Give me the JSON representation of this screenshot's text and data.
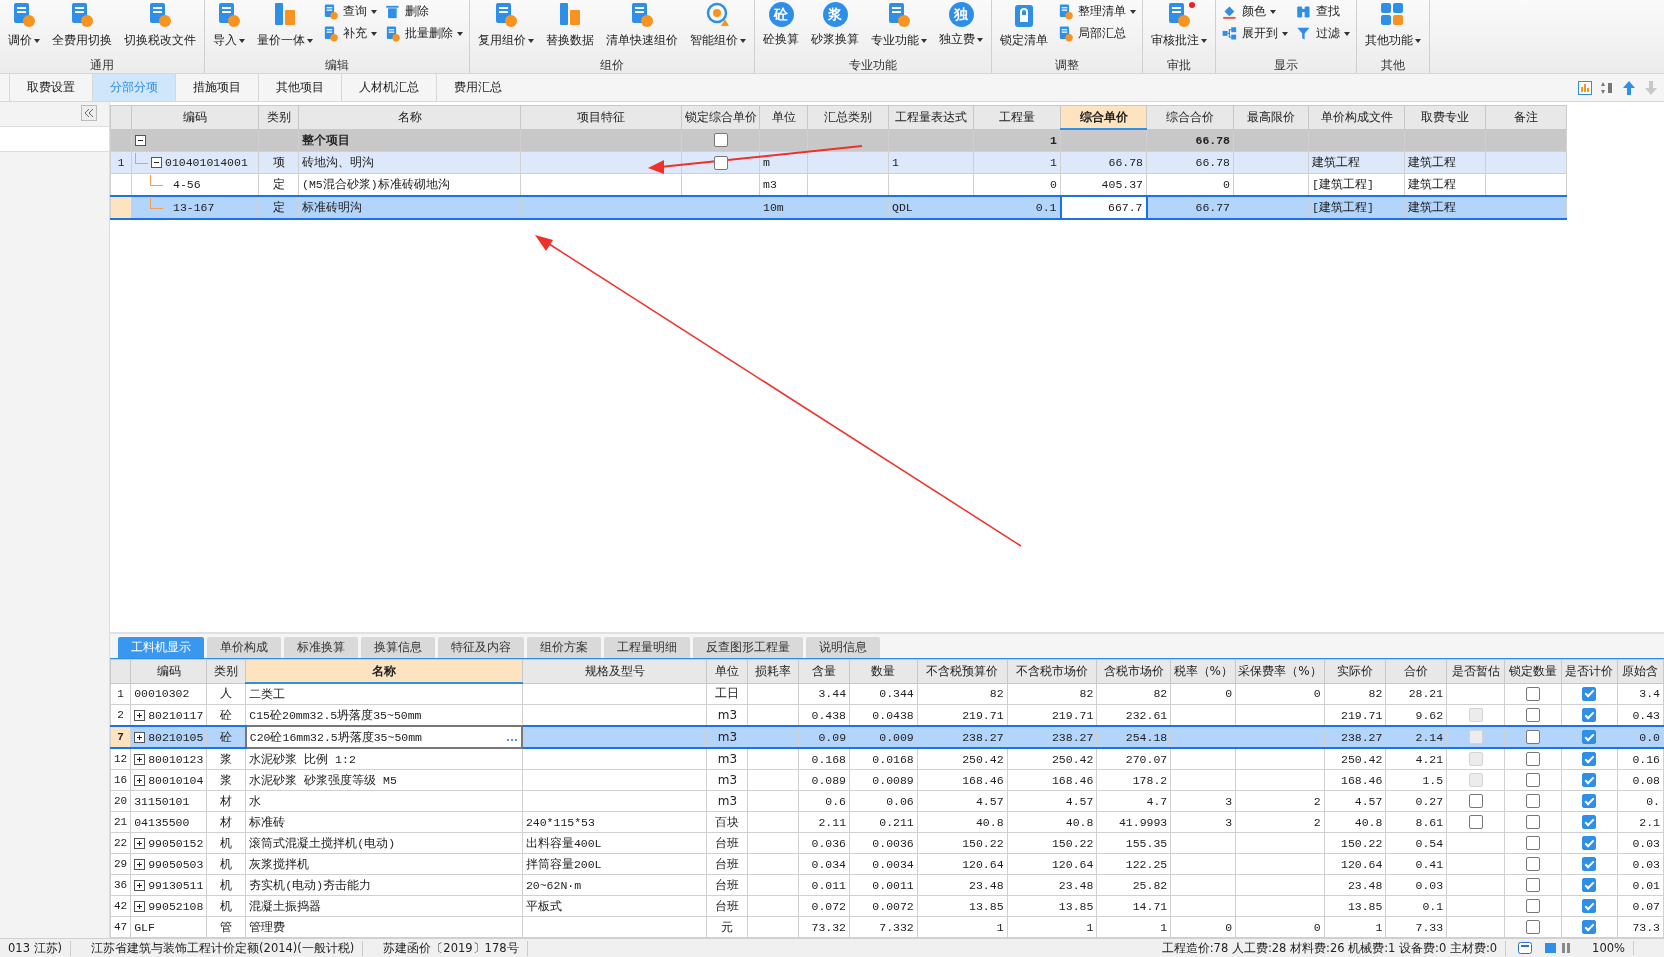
{
  "toolbar": {
    "groups": [
      {
        "label": "通用",
        "items": [
          {
            "kind": "large",
            "label": "调价",
            "dropdown": true
          },
          {
            "kind": "large",
            "label": "全费用切换",
            "dropdown": false
          },
          {
            "kind": "large",
            "label": "切换税改文件",
            "dropdown": false
          }
        ]
      },
      {
        "label": "编辑",
        "items": [
          {
            "kind": "large",
            "label": "导入",
            "dropdown": true
          },
          {
            "kind": "large",
            "label": "量价一体",
            "dropdown": true
          },
          {
            "kind": "stack",
            "items": [
              {
                "label": "查询",
                "dropdown": true
              },
              {
                "label": "补充",
                "dropdown": true
              }
            ]
          },
          {
            "kind": "stack",
            "items": [
              {
                "label": "删除",
                "dropdown": false
              },
              {
                "label": "批量删除",
                "dropdown": true
              }
            ]
          }
        ]
      },
      {
        "label": "组价",
        "items": [
          {
            "kind": "large",
            "label": "复用组价",
            "dropdown": true
          },
          {
            "kind": "large",
            "label": "替换数据",
            "dropdown": false
          },
          {
            "kind": "large",
            "label": "清单快速组价",
            "dropdown": false
          },
          {
            "kind": "large",
            "label": "智能组价",
            "dropdown": true
          }
        ]
      },
      {
        "label": "专业功能",
        "items": [
          {
            "kind": "large",
            "label": "砼换算",
            "glyph": "砼",
            "dropdown": false
          },
          {
            "kind": "large",
            "label": "砂浆换算",
            "glyph": "浆",
            "dropdown": false
          },
          {
            "kind": "large",
            "label": "专业功能",
            "dropdown": true
          },
          {
            "kind": "large",
            "label": "独立费",
            "glyph": "独",
            "dropdown": true
          }
        ]
      },
      {
        "label": "调整",
        "items": [
          {
            "kind": "large",
            "label": "锁定清单",
            "dropdown": false
          },
          {
            "kind": "stack",
            "items": [
              {
                "label": "整理清单",
                "dropdown": true
              },
              {
                "label": "局部汇总",
                "dropdown": false
              }
            ]
          }
        ]
      },
      {
        "label": "审批",
        "items": [
          {
            "kind": "large",
            "label": "审核批注",
            "dropdown": true,
            "notification": true
          }
        ]
      },
      {
        "label": "显示",
        "items": [
          {
            "kind": "stack",
            "items": [
              {
                "label": "颜色",
                "dropdown": true
              },
              {
                "label": "展开到",
                "dropdown": true
              }
            ]
          },
          {
            "kind": "stack",
            "items": [
              {
                "label": "查找",
                "dropdown": false
              },
              {
                "label": "过滤",
                "dropdown": true
              }
            ]
          }
        ]
      },
      {
        "label": "其他",
        "items": [
          {
            "kind": "large",
            "label": "其他功能",
            "dropdown": true
          }
        ]
      }
    ]
  },
  "tabs": [
    {
      "label": "取费设置",
      "selected": false
    },
    {
      "label": "分部分项",
      "selected": true
    },
    {
      "label": "措施项目",
      "selected": false
    },
    {
      "label": "其他项目",
      "selected": false
    },
    {
      "label": "人材机汇总",
      "selected": false
    },
    {
      "label": "费用汇总",
      "selected": false
    }
  ],
  "top_grid": {
    "columns": [
      {
        "kind": "rownum",
        "current": false
      },
      {
        "label": "编码",
        "kind": "tree",
        "current": false
      },
      {
        "label": "类别",
        "kind": "center",
        "current": false
      },
      {
        "label": "名称",
        "kind": "text",
        "current": false
      },
      {
        "label": "项目特征",
        "kind": "text",
        "current": false
      },
      {
        "label": "锁定综合单价",
        "kind": "check",
        "current": false
      },
      {
        "label": "单位",
        "kind": "text",
        "current": false
      },
      {
        "label": "汇总类别",
        "kind": "text",
        "current": false
      },
      {
        "label": "工程量表达式",
        "kind": "text",
        "current": false
      },
      {
        "label": "工程量",
        "kind": "num",
        "current": false
      },
      {
        "label": "综合单价",
        "kind": "num",
        "current": true
      },
      {
        "label": "综合合价",
        "kind": "num",
        "current": false
      },
      {
        "label": "最高限价",
        "kind": "num",
        "current": false
      },
      {
        "label": "单价构成文件",
        "kind": "text",
        "current": false
      },
      {
        "label": "取费专业",
        "kind": "text",
        "current": false
      },
      {
        "label": "备注",
        "kind": "text",
        "current": false
      }
    ],
    "rows": [
      {
        "kind": "root",
        "selected": false,
        "expanded": true,
        "cells": [
          null,
          null,
          null,
          "整个项目",
          null,
          {
            "checked": false
          },
          null,
          null,
          null,
          "1",
          null,
          "66.78",
          null,
          null,
          null,
          null
        ],
        "children": [
          {
            "kind": "item",
            "selected": false,
            "expanded": true,
            "cells": [
              "1",
              "010401014001",
              "项",
              "砖地沟、明沟",
              null,
              {
                "checked": false
              },
              "m",
              null,
              "1",
              "1",
              "66.78",
              "66.78",
              null,
              "建筑工程",
              "建筑工程",
              null
            ],
            "children": [
              {
                "kind": "quota",
                "selected": false,
                "cells": [
                  null,
                  "4-56",
                  "定",
                  "(M5混合砂浆)标准砖砌地沟",
                  null,
                  null,
                  "m3",
                  null,
                  null,
                  "0",
                  "405.37",
                  "0",
                  null,
                  "[建筑工程]",
                  "建筑工程",
                  null
                ]
              },
              {
                "kind": "quota",
                "selected": true,
                "cells": [
                  null,
                  "13-167",
                  "定",
                  "标准砖明沟",
                  null,
                  null,
                  "10m",
                  null,
                  "QDL",
                  "0.1",
                  "667.7",
                  "66.77",
                  null,
                  "[建筑工程]",
                  "建筑工程",
                  null
                ]
              }
            ]
          }
        ]
      }
    ]
  },
  "bottom_tabs": [
    {
      "label": "工料机显示",
      "selected": true
    },
    {
      "label": "单价构成",
      "selected": false
    },
    {
      "label": "标准换算",
      "selected": false
    },
    {
      "label": "换算信息",
      "selected": false
    },
    {
      "label": "特征及内容",
      "selected": false
    },
    {
      "label": "组价方案",
      "selected": false
    },
    {
      "label": "工程量明细",
      "selected": false
    },
    {
      "label": "反查图形工程量",
      "selected": false
    },
    {
      "label": "说明信息",
      "selected": false
    }
  ],
  "bottom_grid": {
    "columns": [
      {
        "kind": "rownum",
        "current": false
      },
      {
        "label": "编码",
        "kind": "tree",
        "current": false
      },
      {
        "label": "类别",
        "kind": "center",
        "current": false
      },
      {
        "label": "名称",
        "kind": "text",
        "current": true
      },
      {
        "label": "规格及型号",
        "kind": "text",
        "current": false
      },
      {
        "label": "单位",
        "kind": "center",
        "current": false
      },
      {
        "label": "损耗率",
        "kind": "num",
        "current": false
      },
      {
        "label": "含量",
        "kind": "num",
        "current": false
      },
      {
        "label": "数量",
        "kind": "num",
        "current": false
      },
      {
        "label": "不含税预算价",
        "kind": "num",
        "current": false
      },
      {
        "label": "不含税市场价",
        "kind": "num",
        "current": false
      },
      {
        "label": "含税市场价",
        "kind": "num",
        "current": false
      },
      {
        "label": "税率（%）",
        "kind": "num",
        "current": false
      },
      {
        "label": "采保费率（%）",
        "kind": "num",
        "current": false
      },
      {
        "label": "实际价",
        "kind": "num",
        "current": false
      },
      {
        "label": "合价",
        "kind": "num",
        "current": false
      },
      {
        "label": "是否暂估",
        "kind": "check",
        "current": false
      },
      {
        "label": "锁定数量",
        "kind": "check",
        "current": false
      },
      {
        "label": "是否计价",
        "kind": "check",
        "current": false
      },
      {
        "label": "原始含",
        "kind": "num",
        "current": false
      }
    ],
    "rows": [
      {
        "selected": false,
        "cells": [
          "1",
          "00010302",
          "人",
          "二类工",
          null,
          "工日",
          null,
          "3.44",
          "0.344",
          "82",
          "82",
          "82",
          "0",
          "0",
          "82",
          "28.21",
          null,
          {
            "checked": false,
            "disabled": false
          },
          {
            "checked": true,
            "disabled": false
          },
          "3.4"
        ]
      },
      {
        "selected": false,
        "expanded": false,
        "cells": [
          "2",
          "80210117",
          "砼",
          "C15砼20mm32.5坍落度35~50mm",
          null,
          "m3",
          null,
          "0.438",
          "0.0438",
          "219.71",
          "219.71",
          "232.61",
          null,
          null,
          "219.71",
          "9.62",
          {
            "checked": false,
            "disabled": true
          },
          {
            "checked": false,
            "disabled": false
          },
          {
            "checked": true,
            "disabled": false
          },
          "0.43"
        ]
      },
      {
        "selected": true,
        "expanded": false,
        "cells": [
          "7",
          "80210105",
          "砼",
          "C20砼16mm32.5坍落度35~50mm",
          null,
          "m3",
          null,
          "0.09",
          "0.009",
          "238.27",
          "238.27",
          "254.18",
          null,
          null,
          "238.27",
          "2.14",
          {
            "checked": false,
            "disabled": true
          },
          {
            "checked": false,
            "disabled": false
          },
          {
            "checked": true,
            "disabled": false
          },
          "0.0"
        ]
      },
      {
        "selected": false,
        "expanded": false,
        "cells": [
          "12",
          "80010123",
          "浆",
          "水泥砂浆 比例 1:2",
          null,
          "m3",
          null,
          "0.168",
          "0.0168",
          "250.42",
          "250.42",
          "270.07",
          null,
          null,
          "250.42",
          "4.21",
          {
            "checked": false,
            "disabled": true
          },
          {
            "checked": false,
            "disabled": false
          },
          {
            "checked": true,
            "disabled": false
          },
          "0.16"
        ]
      },
      {
        "selected": false,
        "expanded": false,
        "cells": [
          "16",
          "80010104",
          "浆",
          "水泥砂浆 砂浆强度等级 M5",
          null,
          "m3",
          null,
          "0.089",
          "0.0089",
          "168.46",
          "168.46",
          "178.2",
          null,
          null,
          "168.46",
          "1.5",
          {
            "checked": false,
            "disabled": true
          },
          {
            "checked": false,
            "disabled": false
          },
          {
            "checked": true,
            "disabled": false
          },
          "0.08"
        ]
      },
      {
        "selected": false,
        "cells": [
          "20",
          "31150101",
          "材",
          "水",
          null,
          "m3",
          null,
          "0.6",
          "0.06",
          "4.57",
          "4.57",
          "4.7",
          "3",
          "2",
          "4.57",
          "0.27",
          {
            "checked": false,
            "disabled": false
          },
          {
            "checked": false,
            "disabled": false
          },
          {
            "checked": true,
            "disabled": false
          },
          "0."
        ]
      },
      {
        "selected": false,
        "cells": [
          "21",
          "04135500",
          "材",
          "标准砖",
          "240*115*53",
          "百块",
          null,
          "2.11",
          "0.211",
          "40.8",
          "40.8",
          "41.9993",
          "3",
          "2",
          "40.8",
          "8.61",
          {
            "checked": false,
            "disabled": false
          },
          {
            "checked": false,
            "disabled": false
          },
          {
            "checked": true,
            "disabled": false
          },
          "2.1"
        ]
      },
      {
        "selected": false,
        "expanded": false,
        "cells": [
          "22",
          "99050152",
          "机",
          "滚筒式混凝土搅拌机(电动)",
          "出料容量400L",
          "台班",
          null,
          "0.036",
          "0.0036",
          "150.22",
          "150.22",
          "155.35",
          null,
          null,
          "150.22",
          "0.54",
          null,
          {
            "checked": false,
            "disabled": false
          },
          {
            "checked": true,
            "disabled": false
          },
          "0.03"
        ]
      },
      {
        "selected": false,
        "expanded": false,
        "cells": [
          "29",
          "99050503",
          "机",
          "灰浆搅拌机",
          "拌筒容量200L",
          "台班",
          null,
          "0.034",
          "0.0034",
          "120.64",
          "120.64",
          "122.25",
          null,
          null,
          "120.64",
          "0.41",
          null,
          {
            "checked": false,
            "disabled": false
          },
          {
            "checked": true,
            "disabled": false
          },
          "0.03"
        ]
      },
      {
        "selected": false,
        "expanded": false,
        "cells": [
          "36",
          "99130511",
          "机",
          "夯实机(电动)夯击能力",
          "20~62N·m",
          "台班",
          null,
          "0.011",
          "0.0011",
          "23.48",
          "23.48",
          "25.82",
          null,
          null,
          "23.48",
          "0.03",
          null,
          {
            "checked": false,
            "disabled": false
          },
          {
            "checked": true,
            "disabled": false
          },
          "0.01"
        ]
      },
      {
        "selected": false,
        "expanded": false,
        "cells": [
          "42",
          "99052108",
          "机",
          "混凝土振捣器",
          "平板式",
          "台班",
          null,
          "0.072",
          "0.0072",
          "13.85",
          "13.85",
          "14.71",
          null,
          null,
          "13.85",
          "0.1",
          null,
          {
            "checked": false,
            "disabled": false
          },
          {
            "checked": true,
            "disabled": false
          },
          "0.07"
        ]
      },
      {
        "selected": false,
        "cells": [
          "47",
          "GLF",
          "管",
          "管理费",
          null,
          "元",
          null,
          "73.32",
          "7.332",
          "1",
          "1",
          "1",
          "0",
          "0",
          "1",
          "7.33",
          null,
          {
            "checked": false,
            "disabled": false
          },
          {
            "checked": true,
            "disabled": false
          },
          "73.3"
        ]
      }
    ]
  },
  "status_bar": {
    "left": [
      "013 江苏)",
      "江苏省建筑与装饰工程计价定额(2014)(一般计税)",
      "苏建函价〔2019〕178号"
    ],
    "summary": "工程造价:78  人工费:28  材料费:26  机械费:1  设备费:0  主材费:0",
    "zoom": "100%"
  }
}
